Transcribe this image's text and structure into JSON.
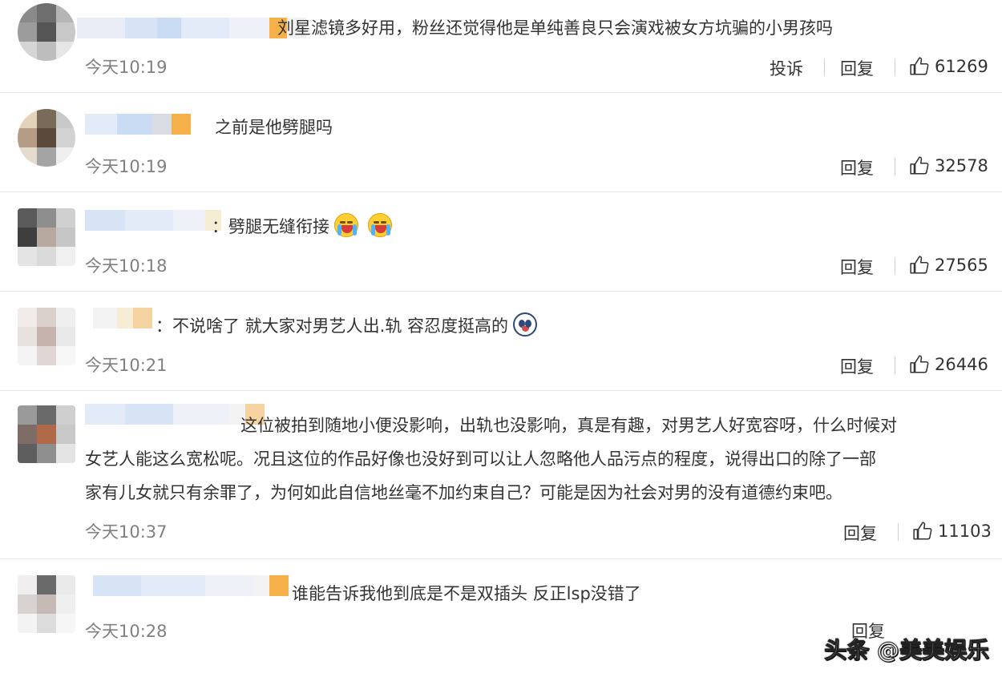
{
  "comments": [
    {
      "text": "刘星滤镜多好用，粉丝还觉得他是单纯善良只会演戏被女方坑骗的小男孩吗",
      "time": "今天10:19",
      "report": "投诉",
      "reply": "回复",
      "likes": "61269"
    },
    {
      "text": "之前是他劈腿吗",
      "time": "今天10:19",
      "reply": "回复",
      "likes": "32578"
    },
    {
      "text": "：劈腿无缝衔接",
      "time": "今天10:18",
      "reply": "回复",
      "likes": "27565",
      "emoji": [
        "crying-face-emoji",
        "crying-face-emoji"
      ]
    },
    {
      "text": "：不说啥了 就大家对男艺人出.轨 容忍度挺高的",
      "time": "今天10:21",
      "reply": "回复",
      "likes": "26446",
      "emoji": [
        "panda-face-emoji"
      ]
    },
    {
      "line1": "这位被拍到随地小便没影响，出轨也没影响，真是有趣，对男艺人好宽容呀，什么时候对",
      "line2": "女艺人能这么宽松呢。况且这位的作品好像也没好到可以让人忽略他人品污点的程度，说得出口的除了一部",
      "line3": "家有儿女就只有余罪了，为何如此自信地丝毫不加约束自己？可能是因为社会对男的没有道德约束吧。",
      "time": "今天10:37",
      "reply": "回复",
      "likes": "11103"
    },
    {
      "text": "谁能告诉我他到底是不是双插头 反正lsp没错了",
      "time": "今天10:28",
      "reply": "回复"
    }
  ],
  "watermark": "头条 @美美娱乐",
  "colors": {
    "text": "#333333",
    "time": "#808080",
    "divider": "#e6e6e6",
    "name_blur_blue": "#c9dcf3",
    "name_blur_orange": "#f5b04a"
  }
}
